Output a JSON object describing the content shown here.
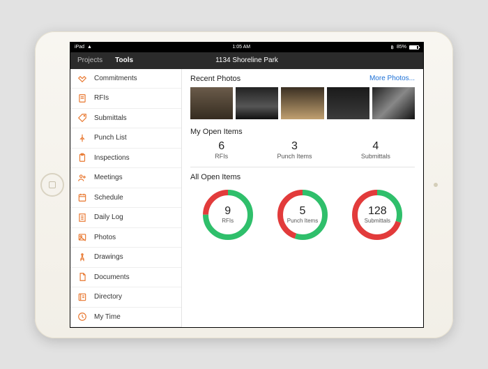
{
  "statusbar": {
    "carrier": "iPad",
    "time": "1:05 AM",
    "battery_pct": "85%"
  },
  "navbar": {
    "projects": "Projects",
    "tools": "Tools",
    "title": "1134 Shoreline Park"
  },
  "sidebar": {
    "items": [
      {
        "label": "Commitments",
        "icon": "handshake"
      },
      {
        "label": "RFIs",
        "icon": "rfi"
      },
      {
        "label": "Submittals",
        "icon": "tag"
      },
      {
        "label": "Punch List",
        "icon": "pin"
      },
      {
        "label": "Inspections",
        "icon": "clipboard"
      },
      {
        "label": "Meetings",
        "icon": "people"
      },
      {
        "label": "Schedule",
        "icon": "calendar"
      },
      {
        "label": "Daily Log",
        "icon": "log"
      },
      {
        "label": "Photos",
        "icon": "photo"
      },
      {
        "label": "Drawings",
        "icon": "compass"
      },
      {
        "label": "Documents",
        "icon": "doc"
      },
      {
        "label": "Directory",
        "icon": "directory"
      },
      {
        "label": "My Time",
        "icon": "clock"
      }
    ]
  },
  "main": {
    "recent_photos_label": "Recent Photos",
    "more_photos_label": "More Photos...",
    "my_open_label": "My Open Items",
    "my_open": [
      {
        "num": "6",
        "label": "RFIs"
      },
      {
        "num": "3",
        "label": "Punch Items"
      },
      {
        "num": "4",
        "label": "Submittals"
      }
    ],
    "all_open_label": "All Open Items",
    "all_open": [
      {
        "num": "9",
        "label": "RFIs",
        "green": 0.75
      },
      {
        "num": "5",
        "label": "Punch Items",
        "green": 0.55
      },
      {
        "num": "128",
        "label": "Submittals",
        "green": 0.3
      }
    ]
  },
  "colors": {
    "accent": "#e8762d",
    "green": "#2fbf6b",
    "red": "#e23b3b",
    "link": "#1a6fd6"
  }
}
